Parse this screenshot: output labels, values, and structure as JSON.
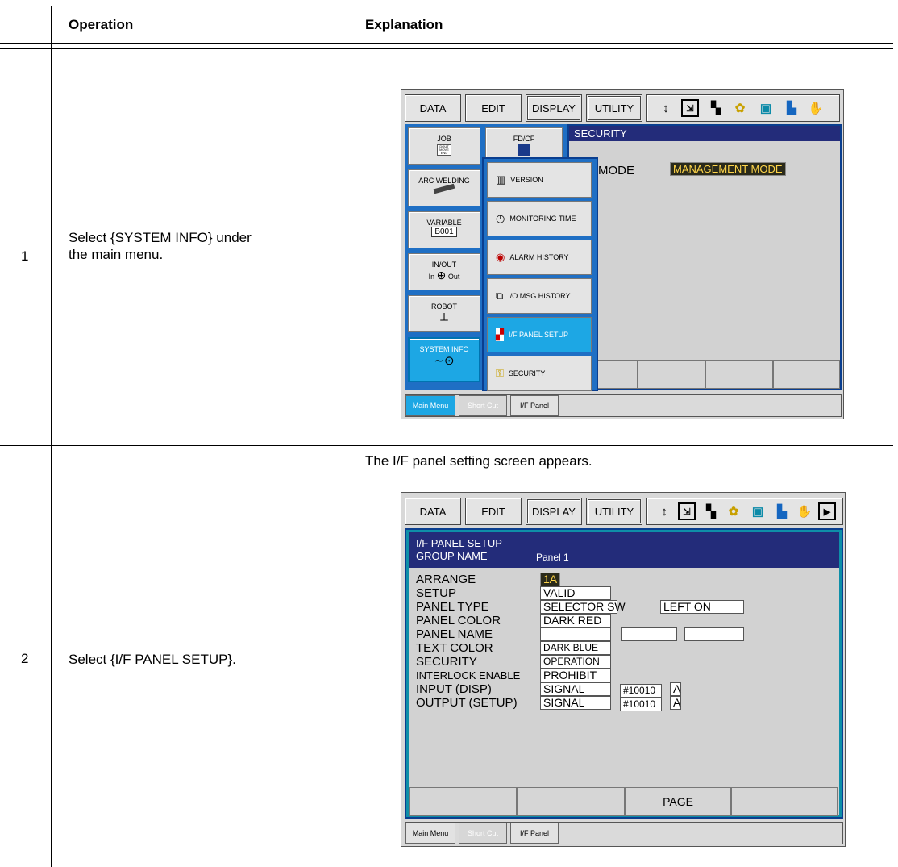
{
  "table": {
    "headers": {
      "operation": "Operation",
      "explanation": "Explanation"
    },
    "steps": [
      {
        "num": "1",
        "operation": "Select {SYSTEM INFO} under the main menu.",
        "explanation": ""
      },
      {
        "num": "2",
        "operation": "Select {I/F PANEL SETUP}.",
        "explanation": "The I/F panel setting screen appears."
      }
    ]
  },
  "pendant1": {
    "menus": [
      "DATA",
      "EDIT",
      "DISPLAY",
      "UTILITY"
    ],
    "status_icons": [
      "robot-axis-icon",
      "coordinate-icon",
      "speed-icon",
      "security-icon",
      "play-icon",
      "edit-icon",
      "hand-icon"
    ],
    "window_title": "SECURITY",
    "mode_label": "MODE",
    "mode_value": "MANAGEMENT MODE",
    "main_menu": [
      {
        "label": "JOB",
        "icon": "job-icon"
      },
      {
        "label": "FD/CF",
        "icon": "floppy-icon"
      },
      {
        "label": "ARC WELDING",
        "icon": "torch-icon"
      },
      {
        "label": "VARIABLE",
        "sub": "B001"
      },
      {
        "label": "IN/OUT",
        "sub_in": "In",
        "sub_out": "Out"
      },
      {
        "label": "ROBOT",
        "icon": "robot-icon"
      },
      {
        "label": "SYSTEM INFO",
        "icon": "system-info-icon"
      }
    ],
    "job_icon_text": "DOUT MOVE END",
    "submenu": [
      {
        "label": "VERSION",
        "icon": "chip-icon"
      },
      {
        "label": "MONITORING TIME",
        "icon": "clock-icon"
      },
      {
        "label": "ALARM HISTORY",
        "icon": "alarm-icon"
      },
      {
        "label": "I/O MSG HISTORY",
        "icon": "io-msg-icon"
      },
      {
        "label": "I/F PANEL SETUP",
        "icon": "panel-icon"
      },
      {
        "label": "SECURITY",
        "icon": "key-icon"
      }
    ],
    "bottom": {
      "main_menu": "Main Menu",
      "short_cut": "Short Cut",
      "if_panel": "I/F Panel"
    }
  },
  "pendant2": {
    "menus": [
      "DATA",
      "EDIT",
      "DISPLAY",
      "UTILITY"
    ],
    "window_title": "I/F PANEL SETUP",
    "group_label": "GROUP NAME",
    "group_value": "Panel 1",
    "fields": [
      {
        "label": "ARRANGE",
        "value": "1A"
      },
      {
        "label": "SETUP",
        "value": "VALID"
      },
      {
        "label": "PANEL TYPE",
        "value": "SELECTOR SW",
        "value2": "LEFT ON"
      },
      {
        "label": "PANEL COLOR",
        "value": "DARK RED"
      },
      {
        "label": "PANEL NAME",
        "value": ""
      },
      {
        "label": "TEXT COLOR",
        "value": "DARK BLUE"
      },
      {
        "label": "SECURITY",
        "value": "OPERATION"
      },
      {
        "label": "INTERLOCK ENABLE",
        "value": "PROHIBIT"
      },
      {
        "label": "INPUT (DISP)",
        "value": "SIGNAL",
        "value2": "#10010",
        "value3": "A"
      },
      {
        "label": "OUTPUT (SETUP)",
        "value": "SIGNAL",
        "value2": "#10010",
        "value3": "A"
      }
    ],
    "fkeys": [
      "",
      "",
      "PAGE",
      ""
    ],
    "bottom": {
      "main_menu": "Main Menu",
      "short_cut": "Short Cut",
      "if_panel": "I/F Panel"
    }
  }
}
